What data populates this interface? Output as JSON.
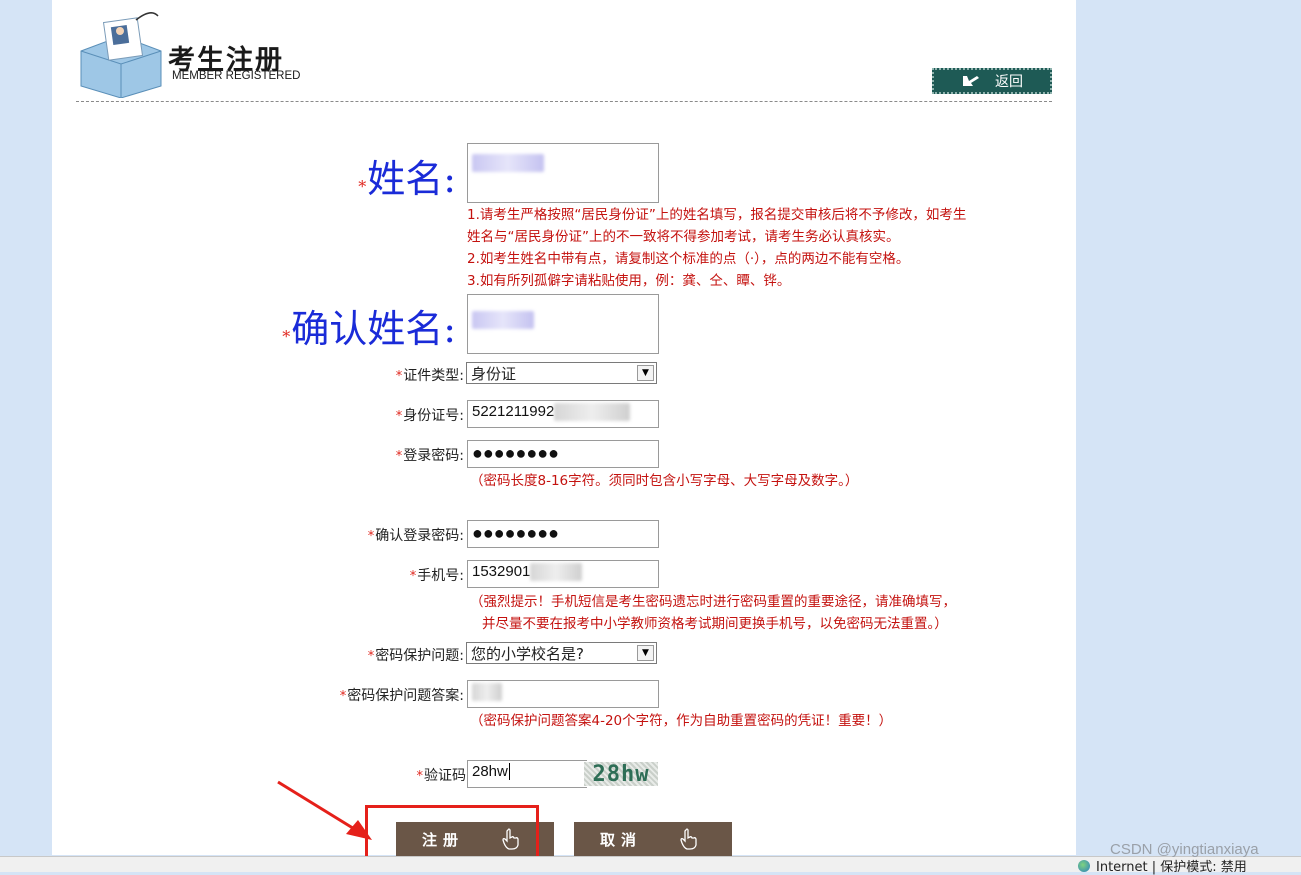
{
  "header": {
    "title_cn": "考生注册",
    "title_en": "MEMBER REGISTERED",
    "back_label": "返回"
  },
  "form": {
    "required_mark": "*",
    "name": {
      "label": "姓名:",
      "value": ""
    },
    "name_notes": [
      "1.请考生严格按照“居民身份证”上的姓名填写，报名提交审核后将不予修改，如考生",
      "姓名与“居民身份证”上的不一致将不得参加考试，请考生务必认真核实。",
      "2.如考生姓名中带有点，请复制这个标准的点（·），点的两边不能有空格。",
      "3.如有所列孤僻字请粘贴使用，例：龚、仝、瞫、铧。"
    ],
    "confirm_name": {
      "label": "确认姓名:",
      "value": ""
    },
    "id_type": {
      "label": "证件类型:",
      "value": "身份证"
    },
    "id_number": {
      "label": "身份证号:",
      "value": "5221211992"
    },
    "password": {
      "label": "登录密码:",
      "value": "●●●●●●●●"
    },
    "password_note": "（密码长度8-16字符。须同时包含小写字母、大写字母及数字。）",
    "confirm_password": {
      "label": "确认登录密码:",
      "value": "●●●●●●●●"
    },
    "phone": {
      "label": "手机号:",
      "value": "1532901"
    },
    "phone_notes": [
      "（强烈提示！手机短信是考生密码遗忘时进行密码重置的重要途径，请准确填写，",
      "并尽量不要在报考中小学教师资格考试期间更换手机号，以免密码无法重置。）"
    ],
    "security_question": {
      "label": "密码保护问题:",
      "value": "您的小学校名是?"
    },
    "security_answer": {
      "label": "密码保护问题答案:",
      "value": ""
    },
    "security_answer_note": "（密码保护问题答案4-20个字符，作为自助重置密码的凭证！重要！）",
    "captcha": {
      "label": "验证码",
      "value": "28hw",
      "image_text": "28hw"
    }
  },
  "buttons": {
    "register": "注册",
    "cancel": "取消"
  },
  "statusbar": {
    "text": "Internet | 保护模式: 禁用"
  },
  "watermark": "CSDN @yingtianxiaya"
}
